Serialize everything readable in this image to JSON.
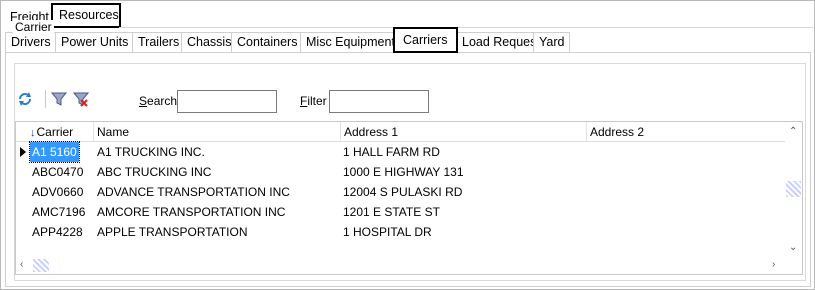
{
  "top_tabs": [
    "Freight",
    "Resources"
  ],
  "sub_tabs": [
    "Drivers",
    "Power Units",
    "Trailers",
    "Chassis",
    "Containers",
    "Misc Equipment",
    "Carriers",
    "Load Request",
    "Yard"
  ],
  "selected_sub_tab": "Carriers",
  "group_title": "Carrier",
  "toolbar": {
    "refresh_icon": "refresh-icon",
    "filter_icon": "filter-icon",
    "clear_filter_icon": "clear-filter-icon",
    "search_label_accel": "S",
    "search_label_rest": "earch",
    "search_value": "",
    "filter_label_accel": "F",
    "filter_label_rest": "ilter",
    "filter_value": ""
  },
  "grid": {
    "columns": [
      "Carrier",
      "Name",
      "Address 1",
      "Address 2"
    ],
    "sort_column": "Carrier",
    "rows": [
      {
        "carrier": "A1 5160",
        "name": "A1 TRUCKING INC.",
        "address1": "1 HALL FARM RD",
        "address2": ""
      },
      {
        "carrier": "ABC0470",
        "name": "ABC TRUCKING INC",
        "address1": "1000 E HIGHWAY 131",
        "address2": ""
      },
      {
        "carrier": "ADV0660",
        "name": "ADVANCE TRANSPORTATION INC",
        "address1": "12004 S PULASKI RD",
        "address2": ""
      },
      {
        "carrier": "AMC7196",
        "name": "AMCORE TRANSPORTATION INC",
        "address1": "1201 E STATE ST",
        "address2": ""
      },
      {
        "carrier": "APP4228",
        "name": "APPLE TRANSPORTATION",
        "address1": "1 HOSPITAL DR",
        "address2": ""
      }
    ],
    "selected_row": 0
  },
  "colors": {
    "selection": "#3399ff",
    "sort_arrow": "#1a3fb0",
    "scroll_thumb": "#c9d2ff"
  }
}
